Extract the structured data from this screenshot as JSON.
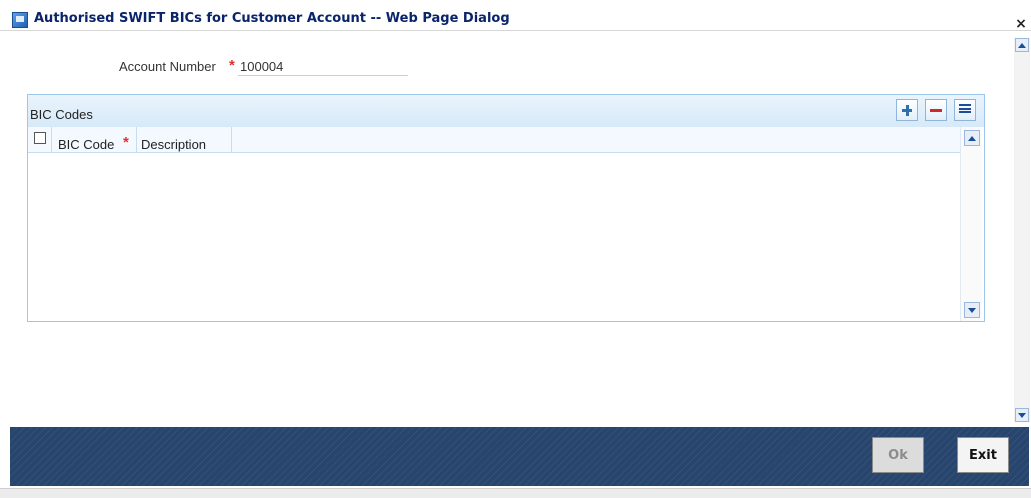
{
  "window": {
    "title": "Authorised SWIFT BICs for Customer Account -- Web Page Dialog",
    "close_symbol": "×"
  },
  "form": {
    "account_number": {
      "label": "Account Number",
      "required_mark": "*",
      "value": "100004"
    }
  },
  "bic_panel": {
    "title": "BIC Codes",
    "toolbar": {
      "add": "plus-icon",
      "delete": "minus-icon",
      "view": "list-icon"
    },
    "columns": [
      {
        "label": "BIC Code",
        "required_mark": "*"
      },
      {
        "label": "Description"
      }
    ],
    "rows": []
  },
  "footer": {
    "ok_label": "Ok",
    "ok_enabled": false,
    "exit_label": "Exit"
  },
  "colors": {
    "title_text": "#0a246a",
    "panel_border": "#9cc7ea",
    "required": "#e03030",
    "footer_bg": "#27456d"
  }
}
